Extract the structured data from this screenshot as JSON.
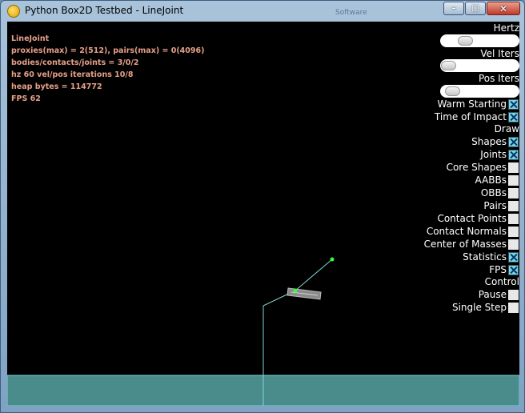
{
  "window": {
    "title": "Python Box2D Testbed - LineJoint",
    "background_label": "Software",
    "buttons": {
      "minimize": "–",
      "maximize": "□",
      "close": "✕"
    }
  },
  "stats": [
    "LineJoint",
    "proxies(max) = 2(512), pairs(max) = 0(4096)",
    "bodies/contacts/joints = 3/0/2",
    "hz 60 vel/pos iterations 10/8",
    "heap bytes = 114772",
    "FPS 62"
  ],
  "panel": {
    "sliders": [
      {
        "label": "Hertz",
        "value": 0.3
      },
      {
        "label": "Vel Iters",
        "value": 0.0
      },
      {
        "label": "Pos Iters",
        "value": 0.1
      }
    ],
    "checkboxes_a": [
      {
        "label": "Warm Starting",
        "checked": true
      },
      {
        "label": "Time of Impact",
        "checked": true
      }
    ],
    "draw_header": "Draw",
    "checkboxes_draw": [
      {
        "label": "Shapes",
        "checked": true
      },
      {
        "label": "Joints",
        "checked": true
      },
      {
        "label": "Core Shapes",
        "checked": false
      },
      {
        "label": "AABBs",
        "checked": false
      },
      {
        "label": "OBBs",
        "checked": false
      },
      {
        "label": "Pairs",
        "checked": false
      },
      {
        "label": "Contact Points",
        "checked": false
      },
      {
        "label": "Contact Normals",
        "checked": false
      },
      {
        "label": "Center of Masses",
        "checked": false
      },
      {
        "label": "Statistics",
        "checked": true
      },
      {
        "label": "FPS",
        "checked": true
      }
    ],
    "control_header": "Control",
    "checkboxes_control": [
      {
        "label": "Pause",
        "checked": false
      },
      {
        "label": "Single Step",
        "checked": false
      }
    ]
  },
  "colors": {
    "ground": "#4a8c8c",
    "joint": "#7fd6d6",
    "box": "#8a8a8a",
    "anchor": "#33ff33",
    "stats_text": "#e6a08a"
  }
}
